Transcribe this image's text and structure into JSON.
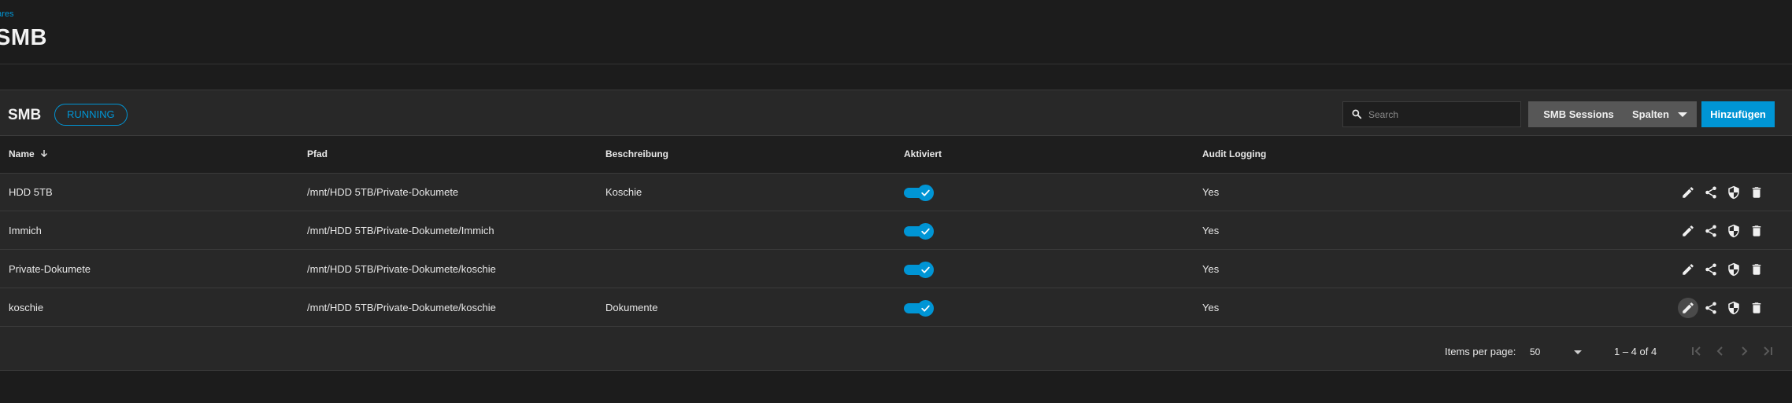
{
  "breadcrumb": "hares",
  "page_title": "SMB",
  "card": {
    "title": "SMB",
    "status": "RUNNING",
    "search_placeholder": "Search",
    "sessions_button": "SMB Sessions",
    "columns_button": "Spalten",
    "add_button": "Hinzufügen"
  },
  "columns": {
    "name": "Name",
    "path": "Pfad",
    "description": "Beschreibung",
    "enabled": "Aktiviert",
    "audit": "Audit Logging"
  },
  "rows": [
    {
      "name": "HDD 5TB",
      "path": "/mnt/HDD 5TB/Private-Dokumete",
      "description": "Koschie",
      "enabled": true,
      "audit": "Yes"
    },
    {
      "name": "Immich",
      "path": "/mnt/HDD 5TB/Private-Dokumete/Immich",
      "description": "",
      "enabled": true,
      "audit": "Yes"
    },
    {
      "name": "Private-Dokumete",
      "path": "/mnt/HDD 5TB/Private-Dokumete/koschie",
      "description": "",
      "enabled": true,
      "audit": "Yes"
    },
    {
      "name": "koschie",
      "path": "/mnt/HDD 5TB/Private-Dokumete/koschie",
      "description": "Dokumente",
      "enabled": true,
      "audit": "Yes"
    }
  ],
  "paginator": {
    "items_label": "Items per page:",
    "page_size": "50",
    "range": "1 – 4 of 4"
  },
  "colors": {
    "accent": "#0095d5",
    "background": "#1c1c1c",
    "card": "#282828"
  }
}
